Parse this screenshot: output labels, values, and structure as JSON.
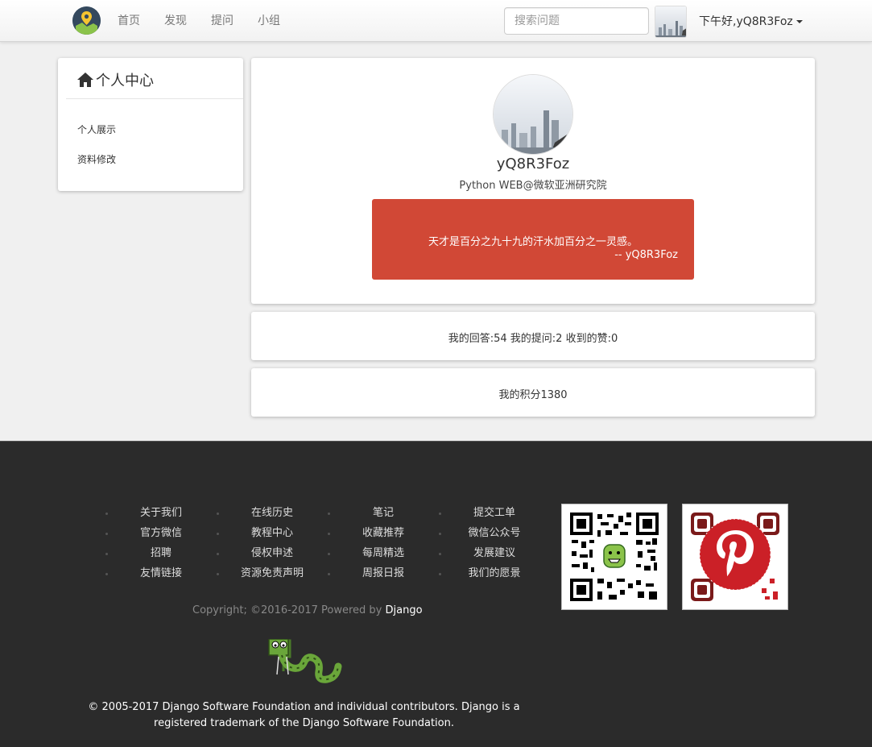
{
  "nav": {
    "links": [
      "首页",
      "发现",
      "提问",
      "小组"
    ],
    "search_placeholder": "搜索问题",
    "greeting": "下午好,yQ8R3Foz"
  },
  "sidebar": {
    "title": "个人中心",
    "items": [
      "个人展示",
      "资料修改"
    ]
  },
  "profile": {
    "username": "yQ8R3Foz",
    "job": "Python WEB@微软亚洲研究院",
    "quote": "天才是百分之九十九的汗水加百分之一灵感。",
    "quote_author": "-- yQ8R3Foz",
    "quote_color": "#d14836"
  },
  "stats": {
    "text": "我的回答:54 我的提问:2 收到的赞:0"
  },
  "points": {
    "text": "我的积分1380"
  },
  "footer": {
    "columns": [
      [
        "关于我们",
        "官方微信",
        "招聘",
        "友情链接"
      ],
      [
        "在线历史",
        "教程中心",
        "侵权申述",
        "资源免责声明"
      ],
      [
        "笔记",
        "收藏推荐",
        "每周精选",
        "周报日报"
      ],
      [
        "提交工单",
        "微信公众号",
        "发展建议",
        "我们的愿景"
      ]
    ],
    "copyright_prefix": "Copyright; ©2016-2017 Powered by",
    "copyright_link": "Django",
    "trademark": "© 2005-2017 Django Software Foundation and individual contributors. Django is a registered trademark of the Django Software Foundation."
  },
  "icons": {
    "logo": "map-pin-logo-icon",
    "home": "home-icon",
    "caret": "caret-down-icon",
    "qr_wechat": "wechat-qr-code",
    "qr_pinterest": "pinterest-qr-code"
  },
  "colors": {
    "footer_bg": "#2b2b2b",
    "quote_bg": "#d14836",
    "page_bg": "#f0f0f0"
  }
}
